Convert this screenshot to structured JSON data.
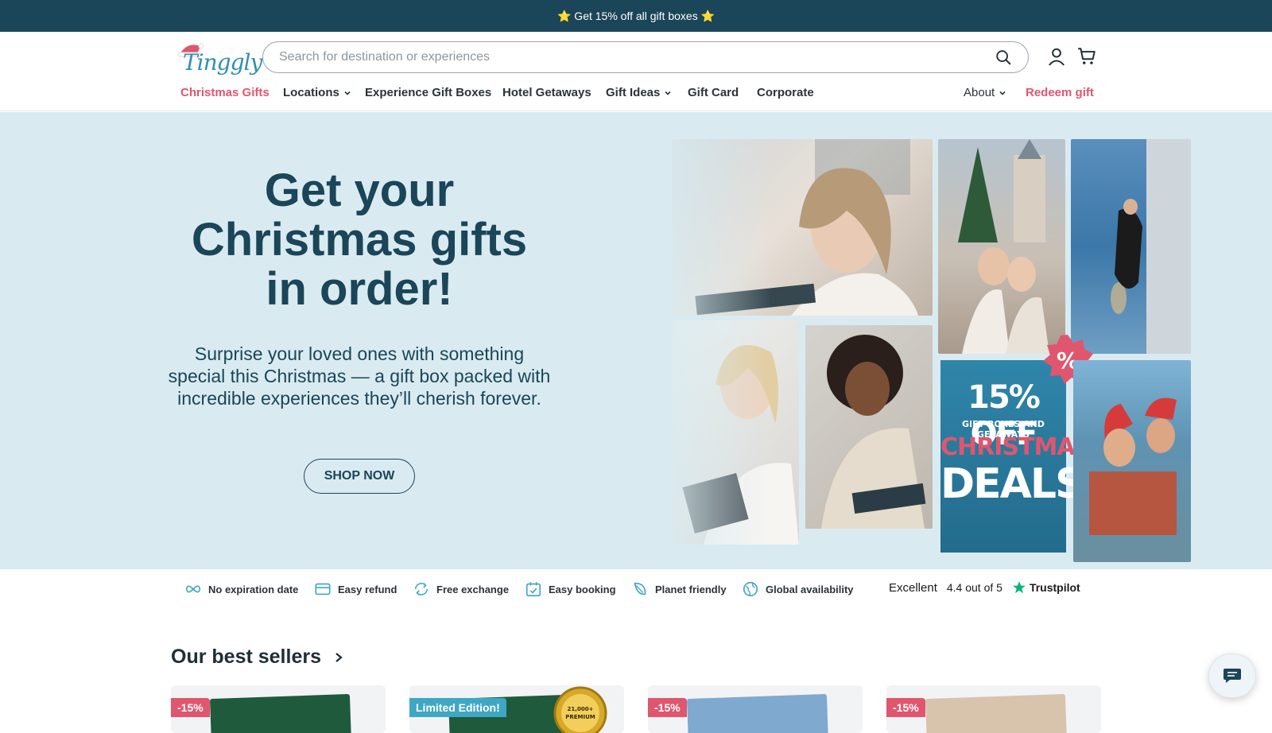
{
  "promo": {
    "text": "⭐ Get 15% off all gift boxes ⭐"
  },
  "header": {
    "logo_text": "Tinggly",
    "search_placeholder": "Search for destination or experiences",
    "search_value": ""
  },
  "nav": {
    "left": [
      {
        "label": "Christmas Gifts",
        "accent": true
      },
      {
        "label": "Locations",
        "dropdown": true
      },
      {
        "label": "Experience Gift Boxes"
      },
      {
        "label": "Hotel Getaways"
      },
      {
        "label": "Gift Ideas",
        "dropdown": true
      },
      {
        "label": "Gift Card"
      },
      {
        "label": "Corporate"
      }
    ],
    "right": [
      {
        "label": "About",
        "dropdown": true
      },
      {
        "label": "Redeem gift",
        "accent": true
      }
    ]
  },
  "hero": {
    "title": "Get your Christmas gifts in order!",
    "subtitle": "Surprise your loved ones with something special this Christmas — a gift box packed with incredible experiences they’ll cherish forever.",
    "cta": "SHOP NOW",
    "deal": {
      "line1": "15% OFF",
      "line2": "GIFT BOXES AND GETAWAYS",
      "line3": "CHRISTMAS",
      "line4": "DEALS",
      "badge": "%"
    }
  },
  "features": [
    {
      "icon": "infinity-icon",
      "label": "No expiration date"
    },
    {
      "icon": "card-icon",
      "label": "Easy refund"
    },
    {
      "icon": "exchange-icon",
      "label": "Free exchange"
    },
    {
      "icon": "calendar-check-icon",
      "label": "Easy booking"
    },
    {
      "icon": "leaf-icon",
      "label": "Planet friendly"
    },
    {
      "icon": "globe-icon",
      "label": "Global availability"
    }
  ],
  "trustpilot": {
    "label": "Excellent",
    "rating": "4.4 out of 5",
    "brand": "Trustpilot"
  },
  "best_sellers": {
    "title": "Our best sellers",
    "cards": [
      {
        "badge": "-15%",
        "badge_type": "sale",
        "box_color": "#1f5a3c"
      },
      {
        "badge": "Limited Edition!",
        "badge_type": "limited",
        "box_color": "#1f5a3c",
        "seal": "21,000+ PREMIUM"
      },
      {
        "badge": "-15%",
        "badge_type": "sale",
        "box_color": "#7fa9cf"
      },
      {
        "badge": "-15%",
        "badge_type": "sale",
        "box_color": "#d8c3ad"
      }
    ]
  },
  "colors": {
    "brand_dark": "#1b4558",
    "accent": "#e0566f",
    "hero_bg": "#d9ebf1",
    "limited": "#3fa7c4"
  }
}
